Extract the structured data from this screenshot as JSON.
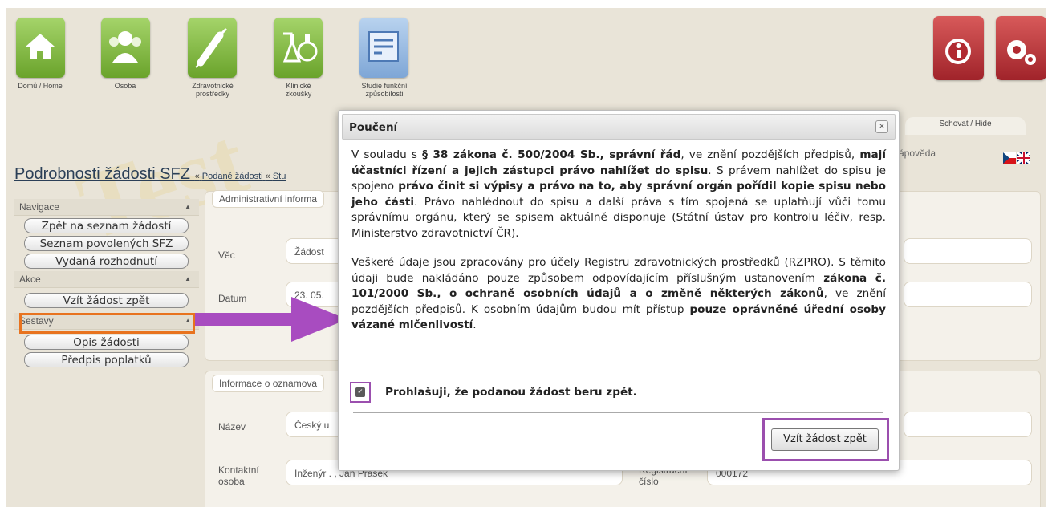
{
  "nav": {
    "tiles": [
      {
        "label": "Domů / Home",
        "icon": "home-icon"
      },
      {
        "label": "Osoba",
        "icon": "people-icon"
      },
      {
        "label": "Zdravotnické\nprostředky",
        "icon": "syringe-icon"
      },
      {
        "label": "Klinické\nzkoušky",
        "icon": "flask-icon"
      },
      {
        "label": "Studie funkční\nzpůsobilosti",
        "icon": "documents-icon"
      }
    ],
    "info_icon": "info-icon",
    "settings_icon": "gear-icon"
  },
  "watermark": "Test",
  "hide_tab": "Schovat / Hide",
  "help_link": "ápověda",
  "page": {
    "title": "Podrobnosti žádosti SFZ",
    "breadcrumb_sep": "«",
    "breadcrumb_1": "Podané žádosti",
    "breadcrumb_2": "Stu"
  },
  "sidebar": {
    "nav_header": "Navigace",
    "nav_items": [
      "Zpět na seznam žádostí",
      "Seznam povolených SFZ",
      "Vydaná rozhodnutí"
    ],
    "actions_header": "Akce",
    "action_items": [
      "Vzít žádost zpět"
    ],
    "reports_header": "Sestavy",
    "report_items": [
      "Opis žádosti",
      "Předpis poplatků"
    ]
  },
  "admin_panel": {
    "title": "Administrativní informa",
    "vec_label": "Věc",
    "vec_value": "Žádost",
    "datum_label": "Datum",
    "datum_value": "23. 05."
  },
  "notifier_panel": {
    "title": "Informace o oznamova",
    "nazev_label": "Název",
    "nazev_value": "Český u",
    "contact_label": "Kontaktní osoba",
    "contact_value": "Inženýr . , Jan Prášek",
    "reg_label": "Registrační číslo",
    "reg_value": "000172"
  },
  "modal": {
    "title": "Poučení",
    "close": "×",
    "p1": [
      {
        "t": "V souladu s ",
        "b": false
      },
      {
        "t": "§ 38 zákona č. 500/2004 Sb., správní řád",
        "b": true
      },
      {
        "t": ", ve znění pozdějších předpisů, ",
        "b": false
      },
      {
        "t": "mají účastníci řízení a jejich zástupci právo nahlížet do spisu",
        "b": true
      },
      {
        "t": ". S právem nahlížet do spisu je spojeno ",
        "b": false
      },
      {
        "t": "právo činit si výpisy a právo na to, aby správní orgán pořídil kopie spisu nebo jeho části",
        "b": true
      },
      {
        "t": ". Právo nahlédnout do spisu a další práva s tím spojená se uplatňují vůči tomu správnímu orgánu, který se spisem aktuálně disponuje (Státní ústav pro kontrolu léčiv, resp. Ministerstvo zdravotnictví ČR).",
        "b": false
      }
    ],
    "p2": [
      {
        "t": "Veškeré údaje jsou zpracovány pro účely Registru zdravotnických prostředků (RZPRO). S těmito údaji bude nakládáno pouze způsobem odpovídajícím příslušným ustanovením ",
        "b": false
      },
      {
        "t": "zákona č. 101/2000 Sb., o ochraně osobních údajů a o změně některých zákonů",
        "b": true
      },
      {
        "t": ", ve znění pozdějších předpisů. K osobním údajům budou mít přístup ",
        "b": false
      },
      {
        "t": "pouze oprávněné úřední osoby vázané mlčenlivostí",
        "b": true
      },
      {
        "t": ".",
        "b": false
      }
    ],
    "checkbox_label": "Prohlašuji, že podanou žádost beru zpět.",
    "checkbox_checked": true,
    "confirm_button": "Vzít žádost zpět"
  },
  "colors": {
    "accent_orange": "#e8731f",
    "highlight_purple": "#9b4fae",
    "arrow_purple": "#a84cc0"
  }
}
